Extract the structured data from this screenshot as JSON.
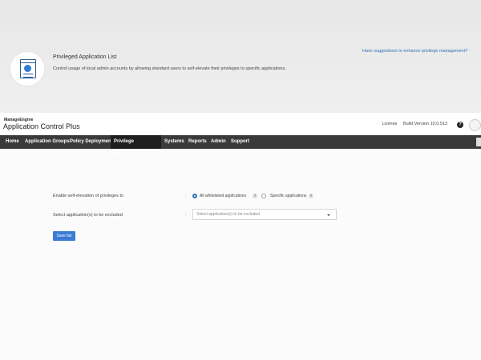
{
  "header": {
    "brand": "ManageEngine",
    "product": "Application Control",
    "product_suffix": "Plus",
    "license": "License",
    "build": "Build Version 10.0.513",
    "help_icon": "question-circle-icon",
    "avatar_icon": "user-avatar-icon"
  },
  "nav": {
    "items": [
      {
        "label": "Home"
      },
      {
        "label": "Application Groups"
      },
      {
        "label": "Policy Deployment"
      },
      {
        "label": "Privilege Management"
      },
      {
        "label": "Systems"
      },
      {
        "label": "Reports"
      },
      {
        "label": "Admin"
      },
      {
        "label": "Support"
      }
    ],
    "active": "Privilege Management"
  },
  "page": {
    "icon": "privileged-app-window-icon",
    "title": "Privileged Application List",
    "suggest_link": "Have suggestions to enhance privilege management?",
    "description": "Control usage of local admin accounts by allowing standard users to self-elevate their privileges to specific applications.",
    "elevation": {
      "label": "Enable self-elevation of privileges to",
      "colon": ":",
      "options": [
        {
          "label": "All whitelisted applications",
          "selected": true
        },
        {
          "label": "Specific applications",
          "selected": false
        }
      ]
    },
    "exclude": {
      "label": "Select application(s) to be excluded",
      "colon": ":",
      "placeholder": "Select application(s) to be excluded"
    },
    "save_label": "Save list"
  },
  "colors": {
    "accent": "#3a7bd5",
    "nav_bg": "#3a3a3a",
    "nav_active": "#1e1e1e",
    "link": "#2f6fb6"
  }
}
